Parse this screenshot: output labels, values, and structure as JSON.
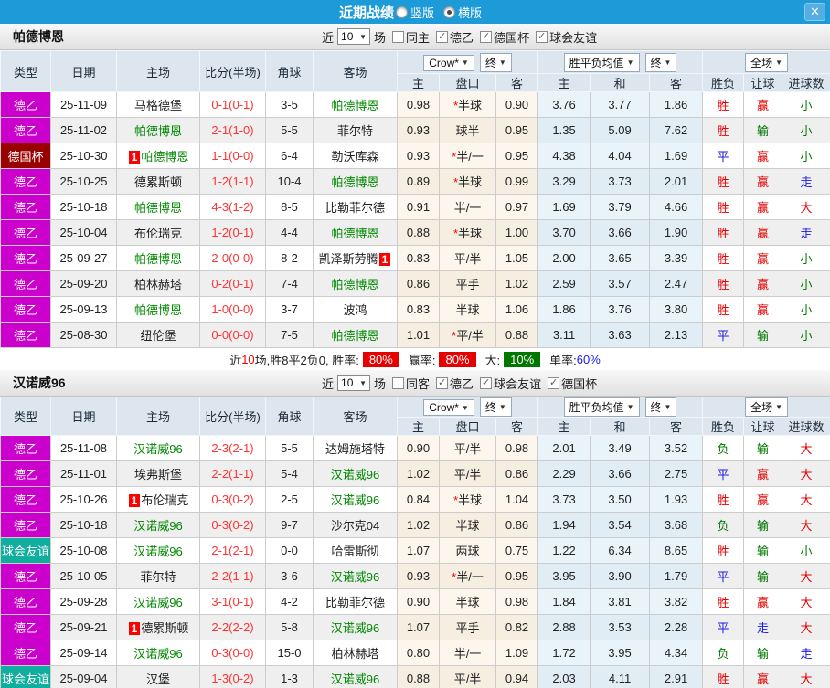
{
  "titlebar": {
    "title": "近期战绩",
    "radios": [
      {
        "label": "竖版",
        "selected": false
      },
      {
        "label": "横版",
        "selected": true
      }
    ],
    "close_label": "✕"
  },
  "table_header": {
    "cols": [
      "类型",
      "日期",
      "主场",
      "比分(半场)",
      "角球",
      "客场"
    ],
    "asia_dropdown": "Crow*",
    "asia_final": "终",
    "europe_dropdown": "胜平负均值",
    "europe_final": "终",
    "scope_dropdown": "全场",
    "asia_sub": [
      "主",
      "盘口",
      "客"
    ],
    "europe_sub": [
      "主",
      "和",
      "客"
    ],
    "result_sub": [
      "胜负",
      "让球",
      "进球数"
    ]
  },
  "type_colors": {
    "德乙": "#cc00cc",
    "德国杯": "#990000",
    "球会友谊": "#0fae9f"
  },
  "result_colors": {
    "胜": "#e60000",
    "赢": "#e60000",
    "大": "#e60000",
    "平": "#1a1ae6",
    "走": "#1a1ae6",
    "负": "#007800",
    "输": "#007800",
    "小": "#007800"
  },
  "cutoff_row": {
    "type_color": "#1e90ff"
  },
  "sections": [
    {
      "team": "帕德博恩",
      "filter": {
        "prefix": "近",
        "count": "10",
        "suffix": "场",
        "checkboxes": [
          {
            "label": "同主",
            "checked": false
          },
          {
            "label": "德乙",
            "checked": true
          },
          {
            "label": "德国杯",
            "checked": true
          },
          {
            "label": "球会友谊",
            "checked": true
          }
        ]
      },
      "rows": [
        {
          "type": "德乙",
          "date": "25-11-09",
          "home": {
            "name": "马格德堡",
            "green": false
          },
          "score": "0-1(0-1)",
          "corner": "3-5",
          "away": {
            "name": "帕德博恩",
            "green": true
          },
          "asia": [
            "0.98",
            "*半球",
            "0.90"
          ],
          "europe": [
            "3.76",
            "3.77",
            "1.86"
          ],
          "results": [
            "胜",
            "赢",
            "小"
          ]
        },
        {
          "type": "德乙",
          "date": "25-11-02",
          "home": {
            "name": "帕德博恩",
            "green": true
          },
          "score": "2-1(1-0)",
          "corner": "5-5",
          "away": {
            "name": "菲尔特",
            "green": false
          },
          "asia": [
            "0.93",
            "球半",
            "0.95"
          ],
          "europe": [
            "1.35",
            "5.09",
            "7.62"
          ],
          "results": [
            "胜",
            "输",
            "小"
          ]
        },
        {
          "type": "德国杯",
          "date": "25-10-30",
          "home": {
            "name": "帕德博恩",
            "green": true,
            "badge": "1"
          },
          "score": "1-1(0-0)",
          "corner": "6-4",
          "away": {
            "name": "勒沃库森",
            "green": false
          },
          "asia": [
            "0.93",
            "*半/一",
            "0.95"
          ],
          "europe": [
            "4.38",
            "4.04",
            "1.69"
          ],
          "results": [
            "平",
            "赢",
            "小"
          ]
        },
        {
          "type": "德乙",
          "date": "25-10-25",
          "home": {
            "name": "德累斯顿",
            "green": false
          },
          "score": "1-2(1-1)",
          "corner": "10-4",
          "away": {
            "name": "帕德博恩",
            "green": true
          },
          "asia": [
            "0.89",
            "*半球",
            "0.99"
          ],
          "europe": [
            "3.29",
            "3.73",
            "2.01"
          ],
          "results": [
            "胜",
            "赢",
            "走"
          ]
        },
        {
          "type": "德乙",
          "date": "25-10-18",
          "home": {
            "name": "帕德博恩",
            "green": true
          },
          "score": "4-3(1-2)",
          "corner": "8-5",
          "away": {
            "name": "比勒菲尔德",
            "green": false
          },
          "asia": [
            "0.91",
            "半/一",
            "0.97"
          ],
          "europe": [
            "1.69",
            "3.79",
            "4.66"
          ],
          "results": [
            "胜",
            "赢",
            "大"
          ]
        },
        {
          "type": "德乙",
          "date": "25-10-04",
          "home": {
            "name": "布伦瑞克",
            "green": false
          },
          "score": "1-2(0-1)",
          "corner": "4-4",
          "away": {
            "name": "帕德博恩",
            "green": true
          },
          "asia": [
            "0.88",
            "*半球",
            "1.00"
          ],
          "europe": [
            "3.70",
            "3.66",
            "1.90"
          ],
          "results": [
            "胜",
            "赢",
            "走"
          ]
        },
        {
          "type": "德乙",
          "date": "25-09-27",
          "home": {
            "name": "帕德博恩",
            "green": true
          },
          "score": "2-0(0-0)",
          "corner": "8-2",
          "away": {
            "name": "凯泽斯劳腾",
            "green": false,
            "badge_after": "1"
          },
          "asia": [
            "0.83",
            "平/半",
            "1.05"
          ],
          "europe": [
            "2.00",
            "3.65",
            "3.39"
          ],
          "results": [
            "胜",
            "赢",
            "小"
          ]
        },
        {
          "type": "德乙",
          "date": "25-09-20",
          "home": {
            "name": "柏林赫塔",
            "green": false
          },
          "score": "0-2(0-1)",
          "corner": "7-4",
          "away": {
            "name": "帕德博恩",
            "green": true
          },
          "asia": [
            "0.86",
            "平手",
            "1.02"
          ],
          "europe": [
            "2.59",
            "3.57",
            "2.47"
          ],
          "results": [
            "胜",
            "赢",
            "小"
          ]
        },
        {
          "type": "德乙",
          "date": "25-09-13",
          "home": {
            "name": "帕德博恩",
            "green": true
          },
          "score": "1-0(0-0)",
          "corner": "3-7",
          "away": {
            "name": "波鸿",
            "green": false
          },
          "asia": [
            "0.83",
            "半球",
            "1.06"
          ],
          "europe": [
            "1.86",
            "3.76",
            "3.80"
          ],
          "results": [
            "胜",
            "赢",
            "小"
          ]
        },
        {
          "type": "德乙",
          "date": "25-08-30",
          "home": {
            "name": "纽伦堡",
            "green": false
          },
          "score": "0-0(0-0)",
          "corner": "7-5",
          "away": {
            "name": "帕德博恩",
            "green": true
          },
          "asia": [
            "1.01",
            "*平/半",
            "0.88"
          ],
          "europe": [
            "3.11",
            "3.63",
            "2.13"
          ],
          "results": [
            "平",
            "输",
            "小"
          ]
        }
      ],
      "summary": {
        "prefix_label": "近",
        "count": "10",
        "mid_text": "场,胜8平2负0, 胜率:",
        "win_rate": "80%",
        "handicap_label": "赢率:",
        "handicap_rate": "80%",
        "big_label": "大:",
        "big_rate": "10%",
        "single_label": "单率:",
        "single_rate": "60%"
      }
    },
    {
      "team": "汉诺威96",
      "filter": {
        "prefix": "近",
        "count": "10",
        "suffix": "场",
        "checkboxes": [
          {
            "label": "同客",
            "checked": false
          },
          {
            "label": "德乙",
            "checked": true
          },
          {
            "label": "球会友谊",
            "checked": true
          },
          {
            "label": "德国杯",
            "checked": true
          }
        ]
      },
      "rows": [
        {
          "type": "德乙",
          "date": "25-11-08",
          "home": {
            "name": "汉诺威96",
            "green": true
          },
          "score": "2-3(2-1)",
          "corner": "5-5",
          "away": {
            "name": "达姆施塔特",
            "green": false
          },
          "asia": [
            "0.90",
            "平/半",
            "0.98"
          ],
          "europe": [
            "2.01",
            "3.49",
            "3.52"
          ],
          "results": [
            "负",
            "输",
            "大"
          ]
        },
        {
          "type": "德乙",
          "date": "25-11-01",
          "home": {
            "name": "埃弗斯堡",
            "green": false
          },
          "score": "2-2(1-1)",
          "corner": "5-4",
          "away": {
            "name": "汉诺威96",
            "green": true
          },
          "asia": [
            "1.02",
            "平/半",
            "0.86"
          ],
          "europe": [
            "2.29",
            "3.66",
            "2.75"
          ],
          "results": [
            "平",
            "赢",
            "大"
          ]
        },
        {
          "type": "德乙",
          "date": "25-10-26",
          "home": {
            "name": "布伦瑞克",
            "green": false,
            "badge": "1"
          },
          "score": "0-3(0-2)",
          "corner": "2-5",
          "away": {
            "name": "汉诺威96",
            "green": true
          },
          "asia": [
            "0.84",
            "*半球",
            "1.04"
          ],
          "europe": [
            "3.73",
            "3.50",
            "1.93"
          ],
          "results": [
            "胜",
            "赢",
            "大"
          ]
        },
        {
          "type": "德乙",
          "date": "25-10-18",
          "home": {
            "name": "汉诺威96",
            "green": true
          },
          "score": "0-3(0-2)",
          "corner": "9-7",
          "away": {
            "name": "沙尔克04",
            "green": false
          },
          "asia": [
            "1.02",
            "半球",
            "0.86"
          ],
          "europe": [
            "1.94",
            "3.54",
            "3.68"
          ],
          "results": [
            "负",
            "输",
            "大"
          ]
        },
        {
          "type": "球会友谊",
          "date": "25-10-08",
          "home": {
            "name": "汉诺威96",
            "green": true
          },
          "score": "2-1(2-1)",
          "corner": "0-0",
          "away": {
            "name": "哈雷斯彻",
            "green": false
          },
          "asia": [
            "1.07",
            "两球",
            "0.75"
          ],
          "europe": [
            "1.22",
            "6.34",
            "8.65"
          ],
          "results": [
            "胜",
            "输",
            "小"
          ]
        },
        {
          "type": "德乙",
          "date": "25-10-05",
          "home": {
            "name": "菲尔特",
            "green": false
          },
          "score": "2-2(1-1)",
          "corner": "3-6",
          "away": {
            "name": "汉诺威96",
            "green": true
          },
          "asia": [
            "0.93",
            "*半/一",
            "0.95"
          ],
          "europe": [
            "3.95",
            "3.90",
            "1.79"
          ],
          "results": [
            "平",
            "输",
            "大"
          ]
        },
        {
          "type": "德乙",
          "date": "25-09-28",
          "home": {
            "name": "汉诺威96",
            "green": true
          },
          "score": "3-1(0-1)",
          "corner": "4-2",
          "away": {
            "name": "比勒菲尔德",
            "green": false
          },
          "asia": [
            "0.90",
            "半球",
            "0.98"
          ],
          "europe": [
            "1.84",
            "3.81",
            "3.82"
          ],
          "results": [
            "胜",
            "赢",
            "大"
          ]
        },
        {
          "type": "德乙",
          "date": "25-09-21",
          "home": {
            "name": "德累斯顿",
            "green": false,
            "badge": "1"
          },
          "score": "2-2(2-2)",
          "corner": "5-8",
          "away": {
            "name": "汉诺威96",
            "green": true
          },
          "asia": [
            "1.07",
            "平手",
            "0.82"
          ],
          "europe": [
            "2.88",
            "3.53",
            "2.28"
          ],
          "results": [
            "平",
            "走",
            "大"
          ]
        },
        {
          "type": "德乙",
          "date": "25-09-14",
          "home": {
            "name": "汉诺威96",
            "green": true
          },
          "score": "0-3(0-0)",
          "corner": "15-0",
          "away": {
            "name": "柏林赫塔",
            "green": false
          },
          "asia": [
            "0.80",
            "半/一",
            "1.09"
          ],
          "europe": [
            "1.72",
            "3.95",
            "4.34"
          ],
          "results": [
            "负",
            "输",
            "走"
          ]
        },
        {
          "type": "球会友谊",
          "date": "25-09-04",
          "home": {
            "name": "汉堡",
            "green": false
          },
          "score": "1-3(0-2)",
          "corner": "1-3",
          "away": {
            "name": "汉诺威96",
            "green": true
          },
          "asia": [
            "0.88",
            "平/半",
            "0.94"
          ],
          "europe": [
            "2.03",
            "4.11",
            "2.91"
          ],
          "results": [
            "胜",
            "赢",
            "大"
          ]
        }
      ]
    }
  ]
}
